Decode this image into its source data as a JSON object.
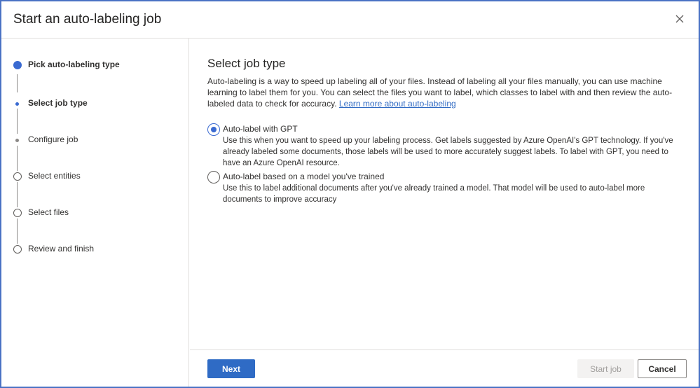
{
  "dialog": {
    "title": "Start an auto-labeling job",
    "close_icon": "close-icon"
  },
  "steps": [
    {
      "label": "Pick auto-labeling type",
      "state": "completed"
    },
    {
      "label": "Select job type",
      "state": "current"
    },
    {
      "label": "Configure job",
      "state": "pending"
    },
    {
      "label": "Select entities",
      "state": "not-started"
    },
    {
      "label": "Select files",
      "state": "not-started"
    },
    {
      "label": "Review and finish",
      "state": "not-started"
    }
  ],
  "main": {
    "heading": "Select job type",
    "description": "Auto-labeling is a way to speed up labeling all of your files. Instead of labeling all your files manually, you can use machine learning to label them for you. You can select the files you want to label, which classes to label with and then review the auto-labeled data to check for accuracy.",
    "learn_more_link": "Learn more about auto-labeling",
    "options": [
      {
        "title": "Auto-label with GPT",
        "description": "Use this when you want to speed up your labeling process. Get labels suggested by Azure OpenAI's GPT technology. If you've already labeled some documents, those labels will be used to more accurately suggest labels. To label with GPT, you need to have an Azure OpenAI resource.",
        "selected": true
      },
      {
        "title": "Auto-label based on a model you've trained",
        "description": "Use this to label additional documents after you've already trained a model. That model will be used to auto-label more documents to improve accuracy",
        "selected": false
      }
    ]
  },
  "footer": {
    "next_label": "Next",
    "start_job_label": "Start job",
    "cancel_label": "Cancel"
  },
  "colors": {
    "accent": "#3a6ad1",
    "frame_border": "#4a72c4",
    "disabled_bg": "#f3f2f1"
  }
}
